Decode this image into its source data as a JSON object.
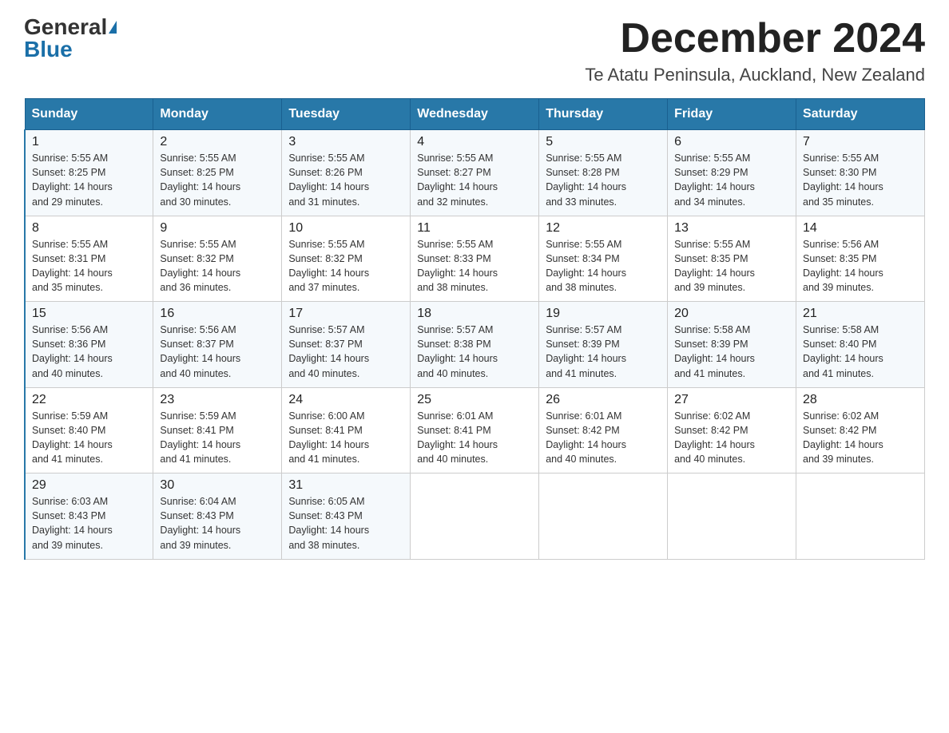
{
  "logo": {
    "general": "General",
    "blue": "Blue"
  },
  "title": "December 2024",
  "subtitle": "Te Atatu Peninsula, Auckland, New Zealand",
  "headers": [
    "Sunday",
    "Monday",
    "Tuesday",
    "Wednesday",
    "Thursday",
    "Friday",
    "Saturday"
  ],
  "weeks": [
    [
      {
        "day": "1",
        "sunrise": "5:55 AM",
        "sunset": "8:25 PM",
        "daylight": "14 hours and 29 minutes."
      },
      {
        "day": "2",
        "sunrise": "5:55 AM",
        "sunset": "8:25 PM",
        "daylight": "14 hours and 30 minutes."
      },
      {
        "day": "3",
        "sunrise": "5:55 AM",
        "sunset": "8:26 PM",
        "daylight": "14 hours and 31 minutes."
      },
      {
        "day": "4",
        "sunrise": "5:55 AM",
        "sunset": "8:27 PM",
        "daylight": "14 hours and 32 minutes."
      },
      {
        "day": "5",
        "sunrise": "5:55 AM",
        "sunset": "8:28 PM",
        "daylight": "14 hours and 33 minutes."
      },
      {
        "day": "6",
        "sunrise": "5:55 AM",
        "sunset": "8:29 PM",
        "daylight": "14 hours and 34 minutes."
      },
      {
        "day": "7",
        "sunrise": "5:55 AM",
        "sunset": "8:30 PM",
        "daylight": "14 hours and 35 minutes."
      }
    ],
    [
      {
        "day": "8",
        "sunrise": "5:55 AM",
        "sunset": "8:31 PM",
        "daylight": "14 hours and 35 minutes."
      },
      {
        "day": "9",
        "sunrise": "5:55 AM",
        "sunset": "8:32 PM",
        "daylight": "14 hours and 36 minutes."
      },
      {
        "day": "10",
        "sunrise": "5:55 AM",
        "sunset": "8:32 PM",
        "daylight": "14 hours and 37 minutes."
      },
      {
        "day": "11",
        "sunrise": "5:55 AM",
        "sunset": "8:33 PM",
        "daylight": "14 hours and 38 minutes."
      },
      {
        "day": "12",
        "sunrise": "5:55 AM",
        "sunset": "8:34 PM",
        "daylight": "14 hours and 38 minutes."
      },
      {
        "day": "13",
        "sunrise": "5:55 AM",
        "sunset": "8:35 PM",
        "daylight": "14 hours and 39 minutes."
      },
      {
        "day": "14",
        "sunrise": "5:56 AM",
        "sunset": "8:35 PM",
        "daylight": "14 hours and 39 minutes."
      }
    ],
    [
      {
        "day": "15",
        "sunrise": "5:56 AM",
        "sunset": "8:36 PM",
        "daylight": "14 hours and 40 minutes."
      },
      {
        "day": "16",
        "sunrise": "5:56 AM",
        "sunset": "8:37 PM",
        "daylight": "14 hours and 40 minutes."
      },
      {
        "day": "17",
        "sunrise": "5:57 AM",
        "sunset": "8:37 PM",
        "daylight": "14 hours and 40 minutes."
      },
      {
        "day": "18",
        "sunrise": "5:57 AM",
        "sunset": "8:38 PM",
        "daylight": "14 hours and 40 minutes."
      },
      {
        "day": "19",
        "sunrise": "5:57 AM",
        "sunset": "8:39 PM",
        "daylight": "14 hours and 41 minutes."
      },
      {
        "day": "20",
        "sunrise": "5:58 AM",
        "sunset": "8:39 PM",
        "daylight": "14 hours and 41 minutes."
      },
      {
        "day": "21",
        "sunrise": "5:58 AM",
        "sunset": "8:40 PM",
        "daylight": "14 hours and 41 minutes."
      }
    ],
    [
      {
        "day": "22",
        "sunrise": "5:59 AM",
        "sunset": "8:40 PM",
        "daylight": "14 hours and 41 minutes."
      },
      {
        "day": "23",
        "sunrise": "5:59 AM",
        "sunset": "8:41 PM",
        "daylight": "14 hours and 41 minutes."
      },
      {
        "day": "24",
        "sunrise": "6:00 AM",
        "sunset": "8:41 PM",
        "daylight": "14 hours and 41 minutes."
      },
      {
        "day": "25",
        "sunrise": "6:01 AM",
        "sunset": "8:41 PM",
        "daylight": "14 hours and 40 minutes."
      },
      {
        "day": "26",
        "sunrise": "6:01 AM",
        "sunset": "8:42 PM",
        "daylight": "14 hours and 40 minutes."
      },
      {
        "day": "27",
        "sunrise": "6:02 AM",
        "sunset": "8:42 PM",
        "daylight": "14 hours and 40 minutes."
      },
      {
        "day": "28",
        "sunrise": "6:02 AM",
        "sunset": "8:42 PM",
        "daylight": "14 hours and 39 minutes."
      }
    ],
    [
      {
        "day": "29",
        "sunrise": "6:03 AM",
        "sunset": "8:43 PM",
        "daylight": "14 hours and 39 minutes."
      },
      {
        "day": "30",
        "sunrise": "6:04 AM",
        "sunset": "8:43 PM",
        "daylight": "14 hours and 39 minutes."
      },
      {
        "day": "31",
        "sunrise": "6:05 AM",
        "sunset": "8:43 PM",
        "daylight": "14 hours and 38 minutes."
      },
      null,
      null,
      null,
      null
    ]
  ],
  "labels": {
    "sunrise": "Sunrise:",
    "sunset": "Sunset:",
    "daylight": "Daylight:"
  }
}
